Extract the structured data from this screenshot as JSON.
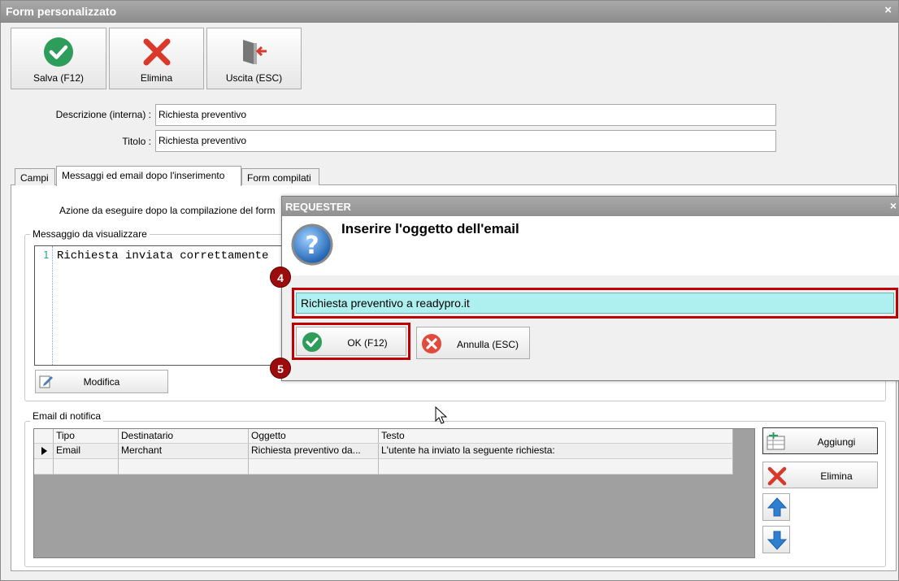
{
  "window": {
    "title": "Form personalizzato",
    "close": "×"
  },
  "toolbar": {
    "save_label": "Salva (F12)",
    "delete_label": "Elimina",
    "exit_label": "Uscita (ESC)"
  },
  "fields": {
    "description_label": "Descrizione (interna) :",
    "description_value": "Richiesta preventivo",
    "title_label": "Titolo :",
    "title_value": "Richiesta preventivo"
  },
  "tabs": [
    {
      "label": "Campi"
    },
    {
      "label": "Messaggi ed email dopo l'inserimento"
    },
    {
      "label": "Form compilati"
    }
  ],
  "panel": {
    "action_text": "Azione da eseguire dopo la compilazione del form",
    "message_group": "Messaggio da visualizzare",
    "editor_line_no": "1",
    "editor_text": "Richiesta inviata correttamente",
    "modify_label": "Modifica",
    "email_group": "Email di notifica"
  },
  "grid": {
    "columns": [
      "Tipo",
      "Destinatario",
      "Oggetto",
      "Testo"
    ],
    "rows": [
      [
        "Email",
        "Merchant",
        "Richiesta preventivo da...",
        "L'utente ha inviato la seguente richiesta:"
      ]
    ]
  },
  "side_buttons": {
    "add_label": "Aggiungi",
    "delete_label": "Elimina"
  },
  "dialog": {
    "title": "REQUESTER",
    "close": "×",
    "prompt": "Inserire l'oggetto dell'email",
    "input_value": "Richiesta preventivo a readypro.it",
    "ok_label": "OK (F12)",
    "cancel_label": "Annulla (ESC)",
    "step4": "4",
    "step5": "5"
  }
}
